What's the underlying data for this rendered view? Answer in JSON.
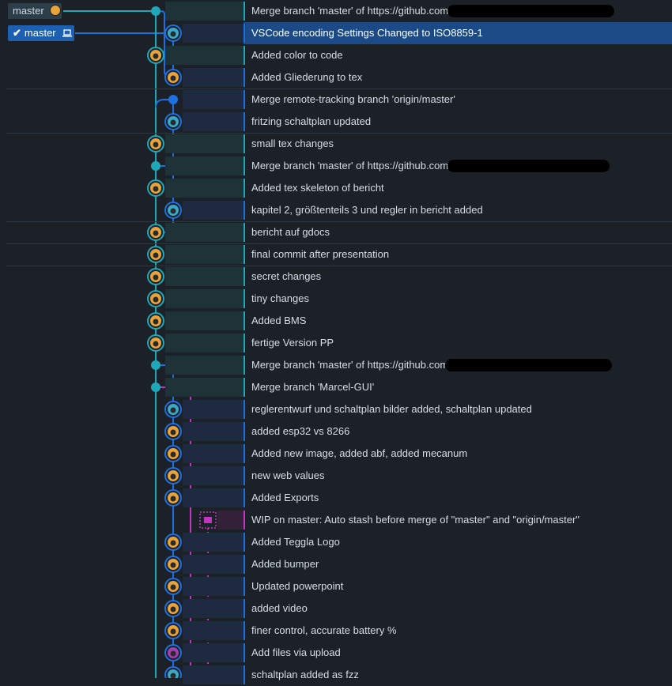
{
  "refs": {
    "remote_label": "master",
    "remote_icon": "github-avatar-icon",
    "local_label": "master",
    "local_icon": "laptop-icon",
    "check_icon": "check-icon"
  },
  "colors": {
    "background": "#1c2128",
    "lane_cyan": "#1fa7b8",
    "lane_blue": "#1e6fe0",
    "lane_magenta": "#c235c2",
    "selected_row": "#1c4a86"
  },
  "commits": [
    {
      "message": "Merge branch 'master' of https://github.com/",
      "lane": 0,
      "kind": "merge",
      "color": "cyan",
      "redacted": true,
      "author_avatar": "cat-avatar-icon"
    },
    {
      "message": "VSCode encoding Settings Changed to ISO8859-1",
      "lane": 1,
      "kind": "avatar",
      "color": "blue",
      "selected": true,
      "author_avatar": "robot-avatar-icon"
    },
    {
      "message": "Added color to code",
      "lane": 0,
      "kind": "avatar",
      "color": "cyan",
      "author_avatar": "cat-avatar-icon"
    },
    {
      "message": "Added Gliederung to tex",
      "lane": 1,
      "kind": "avatar",
      "color": "blue",
      "author_avatar": "cat-avatar-icon"
    },
    {
      "message": "Merge remote-tracking branch 'origin/master'",
      "lane": 1,
      "kind": "merge",
      "color": "blue",
      "author_avatar": "robot-avatar-icon"
    },
    {
      "message": "fritzing schaltplan updated",
      "lane": 1,
      "kind": "avatar",
      "color": "blue",
      "author_avatar": "robot-avatar-icon"
    },
    {
      "message": "small tex changes",
      "lane": 0,
      "kind": "avatar",
      "color": "cyan",
      "author_avatar": "cat-avatar-icon"
    },
    {
      "message": "Merge branch 'master' of https://github.com/",
      "lane": 0,
      "kind": "merge",
      "color": "cyan",
      "redacted": true,
      "author_avatar": "cat-avatar-icon"
    },
    {
      "message": "Added tex skeleton of bericht",
      "lane": 0,
      "kind": "avatar",
      "color": "cyan",
      "author_avatar": "cat-avatar-icon"
    },
    {
      "message": "kapitel 2, größtenteils 3 und regler in bericht added",
      "lane": 1,
      "kind": "avatar",
      "color": "blue",
      "author_avatar": "robot-avatar-icon"
    },
    {
      "message": "bericht auf gdocs",
      "lane": 0,
      "kind": "avatar",
      "color": "cyan",
      "author_avatar": "cat-avatar-icon"
    },
    {
      "message": "final commit after presentation",
      "lane": 0,
      "kind": "avatar",
      "color": "cyan",
      "author_avatar": "cat-avatar-icon"
    },
    {
      "message": "secret changes",
      "lane": 0,
      "kind": "avatar",
      "color": "cyan",
      "author_avatar": "cat-avatar-icon"
    },
    {
      "message": "tiny changes",
      "lane": 0,
      "kind": "avatar",
      "color": "cyan",
      "author_avatar": "cat-avatar-icon"
    },
    {
      "message": "Added BMS",
      "lane": 0,
      "kind": "avatar",
      "color": "cyan",
      "author_avatar": "cat-avatar-icon"
    },
    {
      "message": "fertige Version PP",
      "lane": 0,
      "kind": "avatar",
      "color": "cyan",
      "author_avatar": "block-avatar-icon"
    },
    {
      "message": "Merge branch 'master' of https://github.com/",
      "lane": 0,
      "kind": "merge",
      "color": "cyan",
      "redacted": true,
      "author_avatar": "cat-avatar-icon"
    },
    {
      "message": "Merge branch 'Marcel-GUI'",
      "lane": 0,
      "kind": "merge",
      "color": "cyan",
      "author_avatar": "cat-avatar-icon"
    },
    {
      "message": "reglerentwurf und schaltplan bilder added, schaltplan updated",
      "lane": 1,
      "kind": "avatar",
      "color": "blue",
      "author_avatar": "robot-avatar-icon"
    },
    {
      "message": "added esp32 vs 8266",
      "lane": 1,
      "kind": "avatar",
      "color": "blue",
      "author_avatar": "cat-avatar-icon"
    },
    {
      "message": "Added new image, added abf, added mecanum",
      "lane": 1,
      "kind": "avatar",
      "color": "blue",
      "author_avatar": "cat-avatar-icon"
    },
    {
      "message": "new web values",
      "lane": 1,
      "kind": "avatar",
      "color": "blue",
      "author_avatar": "cat-avatar-icon"
    },
    {
      "message": "Added Exports",
      "lane": 1,
      "kind": "avatar",
      "color": "blue",
      "author_avatar": "cat-avatar-icon"
    },
    {
      "message": "WIP on master: Auto stash before merge of \"master\" and \"origin/master\"",
      "lane": 2,
      "kind": "stash",
      "color": "magenta",
      "author_avatar": "stash-icon"
    },
    {
      "message": "Added Teggla Logo",
      "lane": 1,
      "kind": "avatar",
      "color": "blue",
      "author_avatar": "cat-avatar-icon"
    },
    {
      "message": "Added bumper",
      "lane": 1,
      "kind": "avatar",
      "color": "blue",
      "author_avatar": "cat-avatar-icon"
    },
    {
      "message": "Updated powerpoint",
      "lane": 1,
      "kind": "avatar",
      "color": "blue",
      "author_avatar": "cat-avatar-icon"
    },
    {
      "message": "added video",
      "lane": 1,
      "kind": "avatar",
      "color": "blue",
      "author_avatar": "cat-avatar-icon"
    },
    {
      "message": "finer control, accurate battery %",
      "lane": 1,
      "kind": "avatar",
      "color": "blue",
      "author_avatar": "cat-avatar-icon"
    },
    {
      "message": "Add files via upload",
      "lane": 1,
      "kind": "avatar",
      "color": "blue",
      "author_avatar": "purple-avatar-icon"
    },
    {
      "message": "schaltplan added as fzz",
      "lane": 1,
      "kind": "avatar",
      "color": "blue",
      "author_avatar": "robot-avatar-icon"
    }
  ]
}
